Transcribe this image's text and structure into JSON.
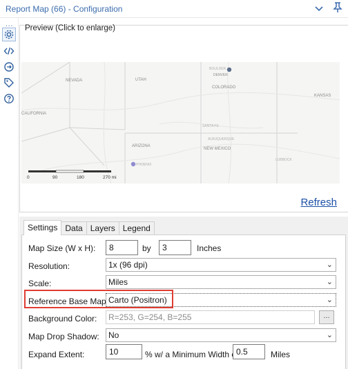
{
  "window": {
    "title": "Report Map (66) - Configuration"
  },
  "rail": {
    "dots": "..."
  },
  "preview": {
    "label": "Preview (Click to enlarge)",
    "refresh_label": "Refresh"
  },
  "map": {
    "states": [
      "NEVADA",
      "UTAH",
      "COLORADO",
      "KANSAS",
      "CALIFORNIA",
      "ARIZONA",
      "NEW MEXICO"
    ],
    "cities": [
      "BOULDER",
      "DENVER",
      "LUBBOCK",
      "ALBUQUERQUE",
      "SANTA FE",
      "PHOENIX",
      "LAS VEGAS",
      "SANTA FE"
    ],
    "scale_labels": [
      "0",
      "90",
      "180",
      "270 mi"
    ]
  },
  "tabs": [
    "Settings",
    "Data",
    "Layers",
    "Legend"
  ],
  "form": {
    "map_size": {
      "label": "Map Size (W x H):",
      "width": "8",
      "by": "by",
      "height": "3",
      "unit": "Inches"
    },
    "resolution": {
      "label": "Resolution:",
      "value": "1x (96 dpi)"
    },
    "scale": {
      "label": "Scale:",
      "value": "Miles"
    },
    "reference_base_map": {
      "label": "Reference Base Map:",
      "value": "Carto (Positron)"
    },
    "background_color": {
      "label": "Background Color:",
      "value": "R=253, G=254, B=255",
      "button": "..."
    },
    "map_drop_shadow": {
      "label": "Map Drop Shadow:",
      "value": "No"
    },
    "expand_extent": {
      "label": "Expand Extent:",
      "value": "10",
      "middle": "% w/ a Minimum Width of",
      "min_width": "0.5",
      "unit": "Miles"
    }
  },
  "colors": {
    "accent": "#3b6cae",
    "highlight": "#e03c31",
    "link": "#1b4fa6"
  }
}
